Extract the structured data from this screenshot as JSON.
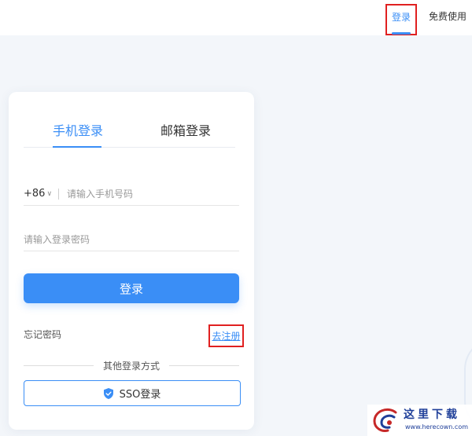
{
  "header": {
    "login_label": "登录",
    "free_trial_label": "免费使用"
  },
  "login_card": {
    "tabs": [
      {
        "label": "手机登录",
        "active": true
      },
      {
        "label": "邮箱登录",
        "active": false
      }
    ],
    "phone": {
      "country_code": "+86",
      "placeholder": "请输入手机号码"
    },
    "password": {
      "placeholder": "请输入登录密码"
    },
    "submit_label": "登录",
    "forgot_label": "忘记密码",
    "register_label": "去注册",
    "other_methods_label": "其他登录方式",
    "sso_label": "SSO登录"
  },
  "watermark": {
    "title": "这里下载",
    "url": "www.herecown.com"
  },
  "colors": {
    "accent": "#3a8ef6",
    "highlight_box": "#e02020"
  }
}
